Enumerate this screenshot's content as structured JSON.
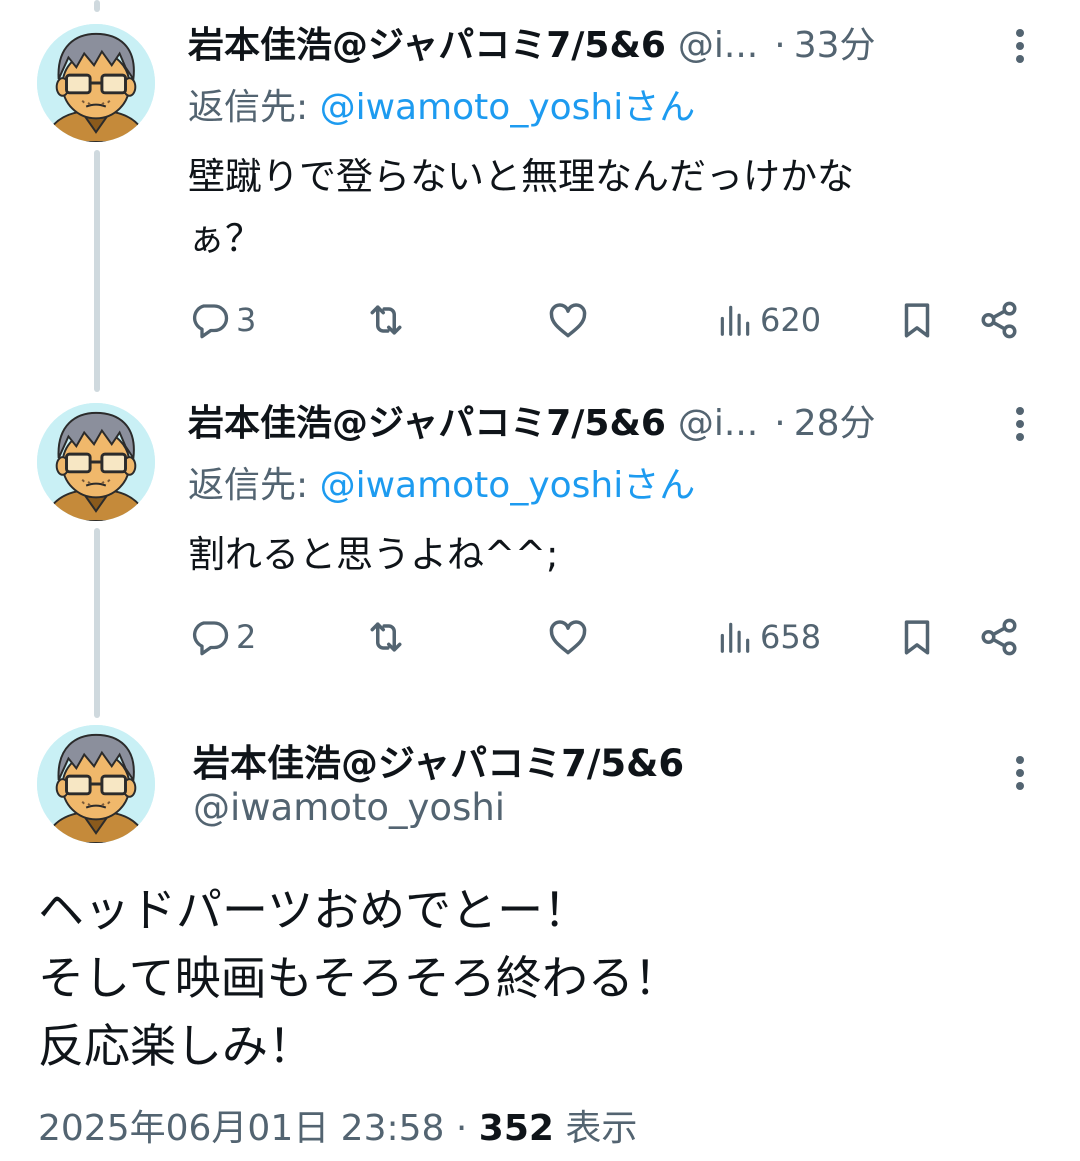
{
  "replies": [
    {
      "display_name": "岩本佳浩@ジャパコミ7/5&6",
      "handle_truncated": "@i...",
      "separator": "·",
      "time": "33分",
      "reply_prefix": "返信先: ",
      "reply_mention": "@iwamoto_yoshiさん",
      "text_lines": [
        "壁蹴りで登らないと無理なんだっけかな",
        "ぁ？"
      ],
      "reply_count": "3",
      "views": "620"
    },
    {
      "display_name": "岩本佳浩@ジャパコミ7/5&6",
      "handle_truncated": "@i...",
      "separator": "·",
      "time": "28分",
      "reply_prefix": "返信先: ",
      "reply_mention": "@iwamoto_yoshiさん",
      "text_lines": [
        "割れると思うよね^^;"
      ],
      "reply_count": "2",
      "views": "658"
    }
  ],
  "main_tweet": {
    "display_name": "岩本佳浩@ジャパコミ7/5&6",
    "handle": "@iwamoto_yoshi",
    "text_lines": [
      "ヘッドパーツおめでとー！",
      "そして映画もそろそろ終わる！",
      "反応楽しみ！"
    ],
    "timestamp": "2025年06月01日 23:58",
    "separator": "·",
    "views_count": "352",
    "views_label": "表示"
  },
  "colors": {
    "text_primary": "#0f1419",
    "text_secondary": "#536471",
    "link": "#1d9bf0",
    "thread_line": "#cfd9de"
  },
  "icons": [
    "reply-icon",
    "retweet-icon",
    "like-icon",
    "views-icon",
    "bookmark-icon",
    "share-icon",
    "more-icon"
  ]
}
